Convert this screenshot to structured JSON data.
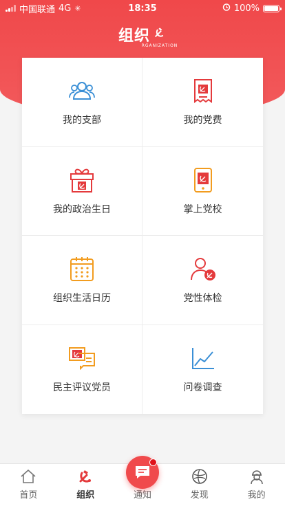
{
  "status_bar": {
    "carrier": "中国联通",
    "network": "4G",
    "time": "18:35",
    "battery": "100%"
  },
  "header": {
    "logo_text": "组织",
    "logo_sub": "RGANIZATION"
  },
  "grid": [
    {
      "label": "我的支部",
      "icon": "people-icon"
    },
    {
      "label": "我的党费",
      "icon": "receipt-icon"
    },
    {
      "label": "我的政治生日",
      "icon": "gift-icon"
    },
    {
      "label": "掌上党校",
      "icon": "tablet-icon"
    },
    {
      "label": "组织生活日历",
      "icon": "calendar-icon"
    },
    {
      "label": "党性体检",
      "icon": "person-check-icon"
    },
    {
      "label": "民主评议党员",
      "icon": "review-icon"
    },
    {
      "label": "问卷调查",
      "icon": "chart-icon"
    }
  ],
  "tabs": [
    {
      "label": "首页",
      "icon": "home-icon"
    },
    {
      "label": "组织",
      "icon": "party-emblem-icon"
    },
    {
      "label": "通知",
      "icon": "message-icon"
    },
    {
      "label": "发现",
      "icon": "compass-icon"
    },
    {
      "label": "我的",
      "icon": "user-icon"
    }
  ],
  "colors": {
    "brand_red": "#f0484a",
    "icon_blue": "#3a8fd6",
    "icon_orange": "#f29c1f",
    "icon_red": "#e43a3c"
  }
}
